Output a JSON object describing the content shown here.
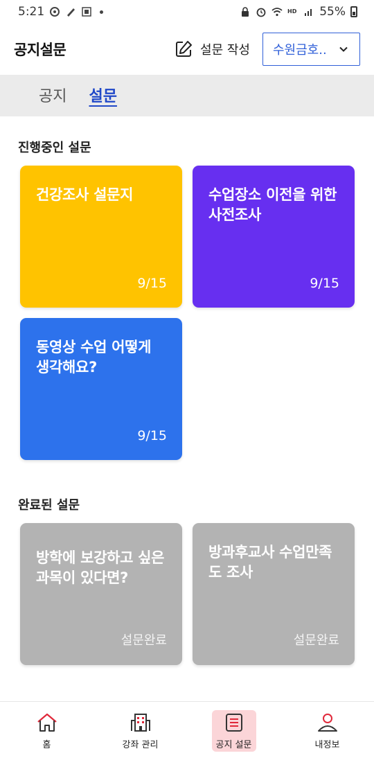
{
  "status_bar": {
    "time": "5:21",
    "battery": "55%"
  },
  "header": {
    "title": "공지설문",
    "write_label": "설문 작성",
    "school_selector": "수원금호.."
  },
  "tabs": [
    {
      "label": "공지",
      "active": false
    },
    {
      "label": "설문",
      "active": true
    }
  ],
  "ongoing": {
    "title": "진행중인 설문",
    "cards": [
      {
        "title": "건강조사 설문지",
        "meta": "9/15",
        "color": "#ffc300"
      },
      {
        "title": "수업장소 이전을 위한 사전조사",
        "meta": "9/15",
        "color": "#672ff0"
      },
      {
        "title": "동영상 수업 어떻게 생각해요?",
        "meta": "9/15",
        "color": "#2d72ec"
      }
    ]
  },
  "completed": {
    "title": "완료된 설문",
    "cards": [
      {
        "title": "방학에 보강하고 싶은 과목이 있다면?",
        "meta": "설문완료",
        "color": "#b3b3b3"
      },
      {
        "title": "방과후교사 수업만족도 조사",
        "meta": "설문완료",
        "color": "#b3b3b3"
      }
    ]
  },
  "bottom_nav": [
    {
      "label": "홈",
      "icon": "home-icon",
      "active": false
    },
    {
      "label": "강좌 관리",
      "icon": "building-icon",
      "active": false
    },
    {
      "label": "공지 설문",
      "icon": "notice-icon",
      "active": true
    },
    {
      "label": "내정보",
      "icon": "person-icon",
      "active": false
    }
  ],
  "colors": {
    "accent": "#2f5fd8",
    "tab_active": "#2048c8",
    "nav_active_bg": "#fbd5d8",
    "nav_icon_red": "#e0283a"
  }
}
